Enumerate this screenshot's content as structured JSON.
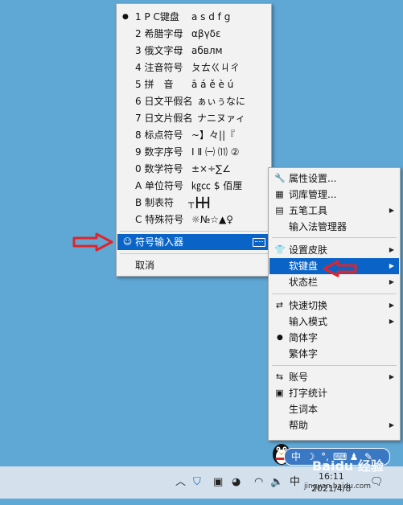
{
  "softkb_menu": {
    "items": [
      {
        "label": "1 P C键盘",
        "example": "a s d f g",
        "checked": true
      },
      {
        "label": "2 希腊字母",
        "example": "αβγδε"
      },
      {
        "label": "3 俄文字母",
        "example": "абвлм"
      },
      {
        "label": "4 注音符号",
        "example": "ㄆㄊㄍㄐㄔ"
      },
      {
        "label": "5 拼　音",
        "example": "ā á ě è ú"
      },
      {
        "label": "6 日文平假名",
        "example": "ぁぃぅなに"
      },
      {
        "label": "7 日文片假名",
        "example": "ナニヌァィ"
      },
      {
        "label": "8 标点符号",
        "example": "~】々||『"
      },
      {
        "label": "9 数字序号",
        "example": "Ⅰ Ⅱ ㈠ ⑾ ②"
      },
      {
        "label": "0 数学符号",
        "example": "±×÷∑∠"
      },
      {
        "label": "A 单位符号",
        "example": "㎏㏄ $ 佰厘"
      },
      {
        "label": "B 制表符",
        "example": "┬┣╋┫"
      },
      {
        "label": "C 特殊符号",
        "example": "☼№☆▲♀"
      }
    ],
    "symbol_input": "符号输入器",
    "cancel": "取消"
  },
  "context_menu": {
    "properties": "属性设置...",
    "lexicon": "词库管理...",
    "wubi_tools": "五笔工具",
    "ime_manager": "输入法管理器",
    "skin": "设置皮肤",
    "soft_keyboard": "软键盘",
    "status_bar": "状态栏",
    "quick_switch": "快速切换",
    "input_mode": "输入模式",
    "simplified": "简体字",
    "traditional": "繁体字",
    "account": "账号",
    "typing_stats": "打字统计",
    "vocab": "生词本",
    "help": "帮助"
  },
  "ime_bar": {
    "lang": "中"
  },
  "taskbar": {
    "ime_indicator": "中",
    "time": "16:11",
    "date": "2021/4/8"
  },
  "watermark": {
    "brand": "Baidu 经验",
    "url": "jingyan.baidu.com"
  },
  "colors": {
    "desktop": "#5fa8d6",
    "highlight": "#0a64c8",
    "arrow": "#e0242a"
  }
}
